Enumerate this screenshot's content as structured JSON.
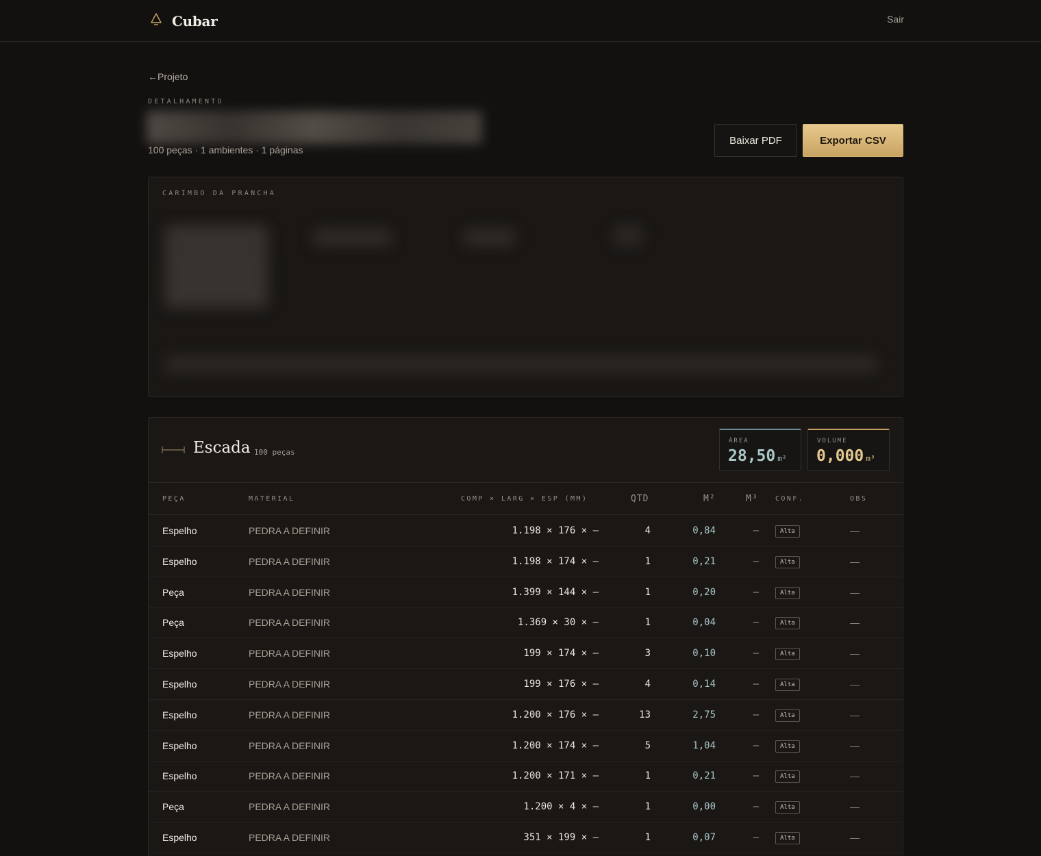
{
  "app": {
    "brand": "Cubar",
    "brand_icon": "pyramid-icon",
    "logout_label": "Sair"
  },
  "page": {
    "back_label": "Projeto",
    "back_icon": "arrow-left-icon",
    "eyebrow": "DETALHAMENTO",
    "summary": "100 peças · 1 ambientes · 1 páginas",
    "btn_pdf": "Baixar PDF",
    "btn_csv": "Exportar CSV"
  },
  "stamp": {
    "label": "CARIMBO DA PRANCHA"
  },
  "section": {
    "title": "Escada",
    "count": "100 peças",
    "metrics": {
      "area_label": "ÁREA",
      "area_value": "28,50",
      "area_unit": "m²",
      "volume_label": "VOLUME",
      "volume_value": "0,000",
      "volume_unit": "m³"
    },
    "columns": {
      "peca": "PEÇA",
      "material": "MATERIAL",
      "dims": "COMP × LARG × ESP (MM)",
      "qtd": "QTD",
      "m2": "M²",
      "m3": "M³",
      "conf": "CONF.",
      "obs": "OBS"
    },
    "rows": [
      {
        "peca": "Espelho",
        "material": "PEDRA A DEFINIR",
        "dims": "1.198 × 176 × —",
        "qtd": "4",
        "m2": "0,84",
        "m3": "—",
        "conf": "Alta",
        "obs": "—"
      },
      {
        "peca": "Espelho",
        "material": "PEDRA A DEFINIR",
        "dims": "1.198 × 174 × —",
        "qtd": "1",
        "m2": "0,21",
        "m3": "—",
        "conf": "Alta",
        "obs": "—"
      },
      {
        "peca": "Peça",
        "material": "PEDRA A DEFINIR",
        "dims": "1.399 × 144 × —",
        "qtd": "1",
        "m2": "0,20",
        "m3": "—",
        "conf": "Alta",
        "obs": "—"
      },
      {
        "peca": "Peça",
        "material": "PEDRA A DEFINIR",
        "dims": "1.369 × 30 × —",
        "qtd": "1",
        "m2": "0,04",
        "m3": "—",
        "conf": "Alta",
        "obs": "—"
      },
      {
        "peca": "Espelho",
        "material": "PEDRA A DEFINIR",
        "dims": "199 × 174 × —",
        "qtd": "3",
        "m2": "0,10",
        "m3": "—",
        "conf": "Alta",
        "obs": "—"
      },
      {
        "peca": "Espelho",
        "material": "PEDRA A DEFINIR",
        "dims": "199 × 176 × —",
        "qtd": "4",
        "m2": "0,14",
        "m3": "—",
        "conf": "Alta",
        "obs": "—"
      },
      {
        "peca": "Espelho",
        "material": "PEDRA A DEFINIR",
        "dims": "1.200 × 176 × —",
        "qtd": "13",
        "m2": "2,75",
        "m3": "—",
        "conf": "Alta",
        "obs": "—"
      },
      {
        "peca": "Espelho",
        "material": "PEDRA A DEFINIR",
        "dims": "1.200 × 174 × —",
        "qtd": "5",
        "m2": "1,04",
        "m3": "—",
        "conf": "Alta",
        "obs": "—"
      },
      {
        "peca": "Espelho",
        "material": "PEDRA A DEFINIR",
        "dims": "1.200 × 171 × —",
        "qtd": "1",
        "m2": "0,21",
        "m3": "—",
        "conf": "Alta",
        "obs": "—"
      },
      {
        "peca": "Peça",
        "material": "PEDRA A DEFINIR",
        "dims": "1.200 × 4 × —",
        "qtd": "1",
        "m2": "0,00",
        "m3": "—",
        "conf": "Alta",
        "obs": "—"
      },
      {
        "peca": "Espelho",
        "material": "PEDRA A DEFINIR",
        "dims": "351 × 199 × —",
        "qtd": "1",
        "m2": "0,07",
        "m3": "—",
        "conf": "Alta",
        "obs": "—"
      }
    ]
  },
  "colors": {
    "accent_gold": "#c9a463",
    "accent_teal": "#a9c7c6",
    "background": "#131110",
    "panel": "#1a1715"
  }
}
